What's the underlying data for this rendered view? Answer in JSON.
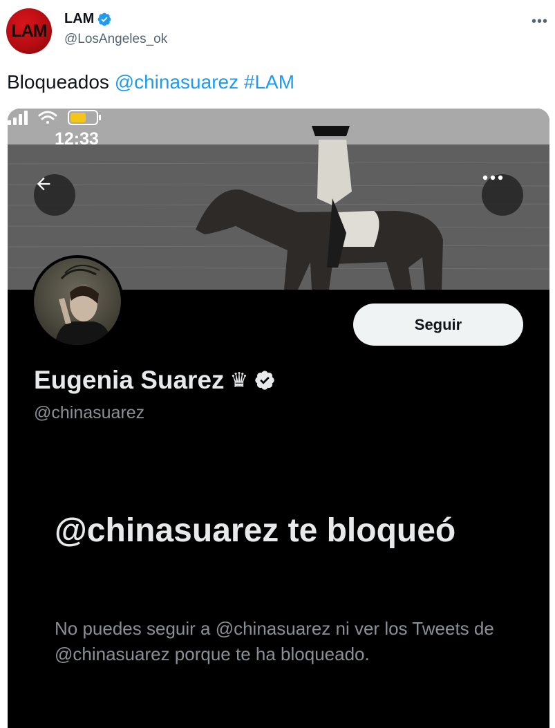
{
  "tweet": {
    "author": {
      "avatar_text": "LAM",
      "name": "LAM",
      "handle": "@LosAngeles_ok",
      "verified": true
    },
    "more_icon": "more-horizontal-icon",
    "text": {
      "prefix": "Bloqueados ",
      "mention": "@chinasuarez",
      "space": " ",
      "hashtag": "#LAM"
    },
    "colors": {
      "link": "#1d9bf0",
      "avatar_red": "#d8151b"
    }
  },
  "screenshot": {
    "status_bar": {
      "time": "12:33",
      "icons": [
        "signal-icon",
        "wifi-icon",
        "battery-icon"
      ]
    },
    "back_icon": "arrow-left-icon",
    "options_icon": "more-horizontal-icon",
    "follow_label": "Seguir",
    "profile": {
      "name": "Eugenia Suarez",
      "name_emoji": "♛",
      "verified": true,
      "handle": "@chinasuarez"
    },
    "blocked": {
      "title": "@chinasuarez te bloqueó",
      "message": "No puedes seguir a @chinasuarez ni ver los Tweets de @chinasuarez porque te ha bloqueado."
    },
    "colors": {
      "background": "#000000",
      "text": "#e7e9ea",
      "muted": "#8b9096",
      "battery": "#f5c518"
    }
  }
}
